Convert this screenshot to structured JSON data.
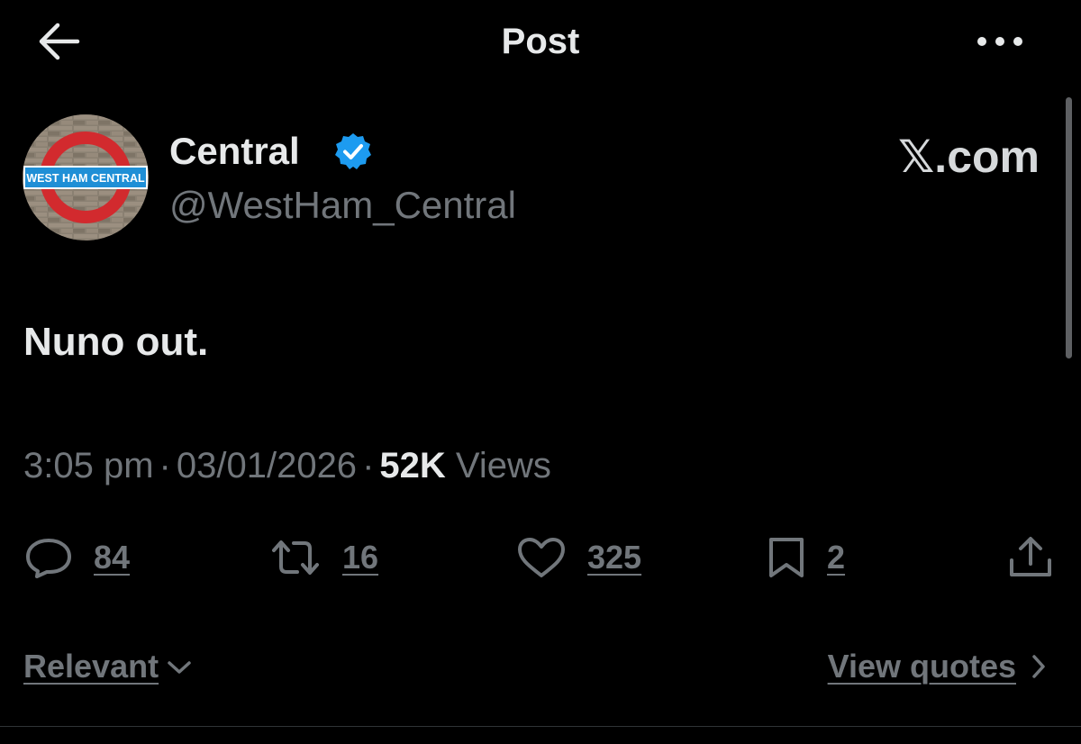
{
  "header": {
    "title": "Post",
    "back_icon": "arrow-left-icon",
    "more_icon": "more-horizontal-icon"
  },
  "post": {
    "author_name": "Central",
    "author_handle": "@WestHam_Central",
    "verified": true,
    "avatar_text": "WEST HAM CENTRAL",
    "watermark": "𝕏.com",
    "text": "Nuno out.",
    "time": "3:05 pm",
    "date": "03/01/2026",
    "views_count": "52K",
    "views_label": "Views"
  },
  "actions": {
    "replies": "84",
    "reposts": "16",
    "likes": "325",
    "bookmarks": "2"
  },
  "footer": {
    "sort_label": "Relevant",
    "quotes_label": "View quotes"
  },
  "colors": {
    "background": "#000000",
    "primary_text": "#e7e9ea",
    "secondary_text": "#71767b",
    "verified_blue": "#1d9bf0",
    "divider": "#2f3336"
  }
}
